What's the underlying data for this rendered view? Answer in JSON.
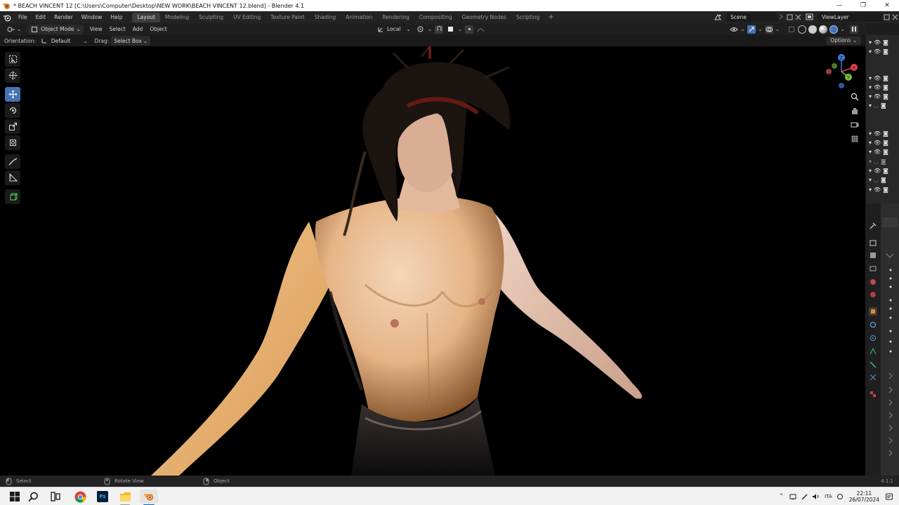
{
  "window": {
    "title": "* BEACH VINCENT 12 [C:\\Users\\Computer\\Desktop\\NEW WORK\\BEACH VINCENT 12.blend] - Blender 4.1",
    "controls": [
      "—",
      "❐",
      "✕"
    ]
  },
  "topbar": {
    "menus": [
      "File",
      "Edit",
      "Render",
      "Window",
      "Help"
    ],
    "workspaces": [
      "Layout",
      "Modeling",
      "Sculpting",
      "UV Editing",
      "Texture Paint",
      "Shading",
      "Animation",
      "Rendering",
      "Compositing",
      "Geometry Nodes",
      "Scripting"
    ],
    "active_workspace": "Layout",
    "add_workspace": "+",
    "scene": "Scene",
    "view_layer": "ViewLayer"
  },
  "viewport_header": {
    "mode": "Object Mode",
    "menus": [
      "View",
      "Select",
      "Add",
      "Object"
    ],
    "transform_orientation": "Local"
  },
  "tool_settings": {
    "orientation_label": "Orientation:",
    "orientation_value": "Default",
    "drag_label": "Drag:",
    "drag_value": "Select Box",
    "options": "Options"
  },
  "gizmo": {
    "z": "Z",
    "x": "X",
    "y": "Y",
    "colors": {
      "x": "#e1404f",
      "y": "#7bbf36",
      "z": "#3b7ee0"
    }
  },
  "toolbar_icons": [
    "select-box-icon",
    "cursor-icon",
    "move-icon",
    "rotate-icon",
    "scale-icon",
    "transform-icon",
    "annotate-icon",
    "measure-icon",
    "add-cube-icon"
  ],
  "statusbar": {
    "left": "Select",
    "middle": "Rotate View",
    "right": "Object",
    "version": "4.1.1"
  },
  "taskbar": {
    "language": "ITA",
    "time": "22:11",
    "date": "26/07/2024",
    "apps": [
      "windows-start-icon",
      "search-icon",
      "task-view-icon",
      "chrome-icon",
      "photoshop-icon",
      "file-explorer-icon",
      "blender-icon"
    ],
    "photoshop_label": "Ps"
  },
  "colors": {
    "accent": "#4772b3",
    "blender_orange": "#e87d0d",
    "viewport_bg": "#000000"
  }
}
